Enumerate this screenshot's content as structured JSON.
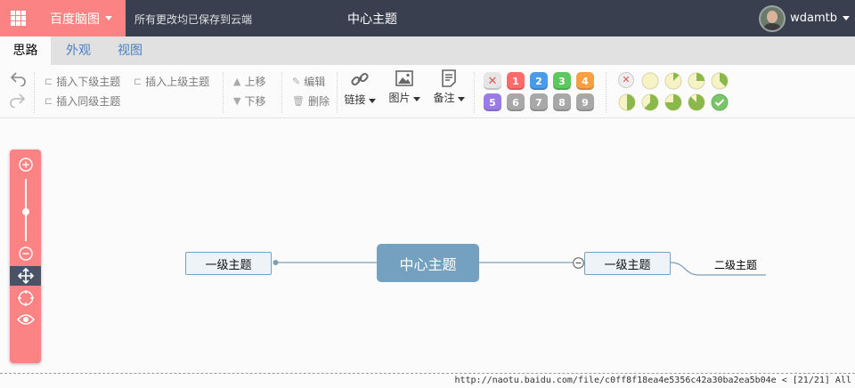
{
  "header": {
    "app_name": "百度脑图",
    "save_status": "所有更改均已保存到云端",
    "document_title": "中心主题",
    "username": "wdamtb"
  },
  "tabs": [
    {
      "label": "思路",
      "active": true
    },
    {
      "label": "外观",
      "active": false
    },
    {
      "label": "视图",
      "active": false
    }
  ],
  "toolbar": {
    "insert_child": "插入下级主题",
    "insert_parent": "插入上级主题",
    "insert_sibling": "插入同级主题",
    "move_up": "上移",
    "move_down": "下移",
    "edit": "编辑",
    "delete": "删除",
    "link": "链接",
    "image": "图片",
    "note": "备注",
    "priorities": [
      "1",
      "2",
      "3",
      "4",
      "5",
      "6",
      "7",
      "8",
      "9"
    ],
    "priority_colors": [
      "#ff6b6b",
      "#4a9be8",
      "#5dc85d",
      "#f7a042",
      "#9b7be8",
      "#a8a8a8",
      "#a8a8a8",
      "#a8a8a8",
      "#a8a8a8"
    ],
    "progress_levels": [
      0,
      0.125,
      0.25,
      0.375,
      0.5,
      0.625,
      0.75,
      0.875,
      1
    ]
  },
  "mindmap": {
    "central": "中心主题",
    "left_topic": "一级主题",
    "right_topic": "一级主题",
    "sub_topic": "二级主题"
  },
  "colors": {
    "accent": "#fc8383",
    "topbar": "#3a3f4f",
    "central_node": "#73a1bf",
    "link": "#4b7fc0"
  },
  "status_bar": {
    "text": "http://naotu.baidu.com/file/c0ff8f18ea4e5356c42a30ba2ea5b04e < [21/21] All"
  }
}
